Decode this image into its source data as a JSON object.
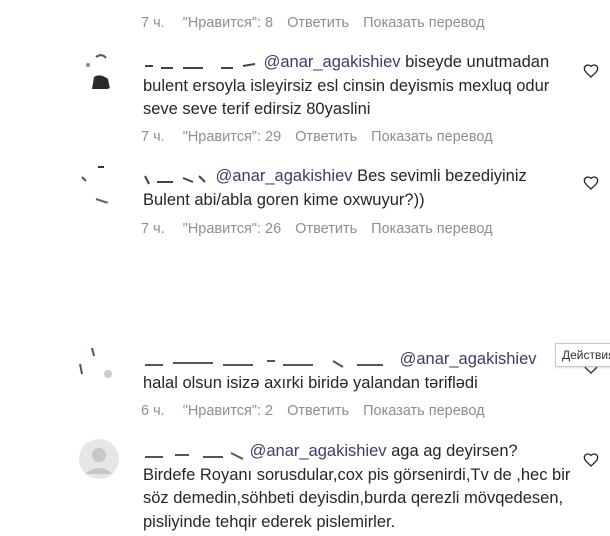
{
  "top_meta": {
    "time": "7 ч.",
    "likes": "\"Нравится\": 8",
    "reply": "Ответить",
    "translate": "Показать перевод"
  },
  "comments": [
    {
      "mention": "@anar_agakishiev",
      "text": " biseyde unutmadan bulent ersoyla isleyirsiz esl cinsin deyismis mexluq odur seve seve terif edirsiz 80yaslini",
      "time": "7 ч.",
      "likes": "\"Нравится\": 29",
      "reply": "Ответить",
      "translate": "Показать перевод"
    },
    {
      "mention": "@anar_agakishiev",
      "text": " Bes sevimli bezediyiniz Bulent abi/abla goren kime oxwuyur?))",
      "time": "7 ч.",
      "likes": "\"Нравится\": 26",
      "reply": "Ответить",
      "translate": "Показать перевод"
    },
    {
      "mention": "@anar_agakishiev",
      "text": "halal olsun isizə axırki biridə yalandan təriflədi",
      "time": "6 ч.",
      "likes": "\"Нравится\": 2",
      "reply": "Ответить",
      "translate": "Показать перевод"
    },
    {
      "mention": "@anar_agakishiev",
      "text": " aga ag deyirsen? Birdefe Royanı sorusdular,cox pis görsenirdi,Tv de ,hec bir söz demedin,söhbeti deyisdin,burda qerezli mövqedesen, pisliyinde tehqir ederek pislemirler."
    }
  ],
  "tooltip": "Действия",
  "colors": {
    "meta": "#8e8e8e",
    "text": "#262626",
    "mention": "#3d3d6b"
  }
}
